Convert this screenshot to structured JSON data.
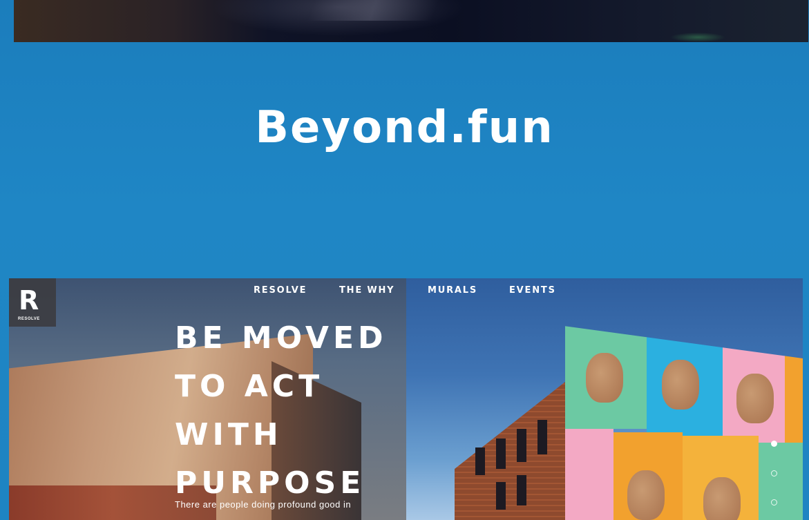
{
  "section": {
    "title": "Beyond.fun"
  },
  "showcase": {
    "logo": {
      "letter": "R",
      "subtext": "RESOLVE"
    },
    "nav": [
      "RESOLVE",
      "THE WHY",
      "MURALS",
      "EVENTS"
    ],
    "hero_lines": [
      "BE MOVED",
      "TO ACT",
      "WITH",
      "PURPOSE"
    ],
    "body_text": "There are people doing profound good in"
  },
  "colors": {
    "background": "#1f86c5",
    "title": "#ffffff",
    "mural_green": "#6cc9a3",
    "mural_blue": "#2bb0e0",
    "mural_pink": "#f3a9c4",
    "mural_orange": "#f2a12e"
  }
}
